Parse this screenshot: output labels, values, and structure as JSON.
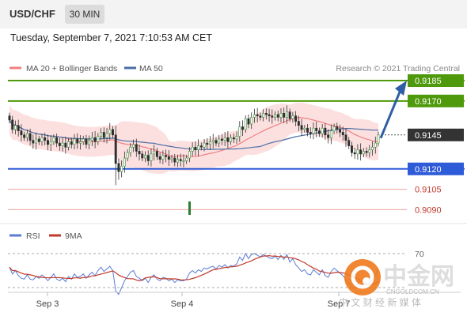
{
  "header": {
    "pair": "USD/CHF",
    "timeframe": "30 MIN",
    "timestamp": "Tuesday, September 7, 2021 7:10:53 AM CET"
  },
  "legend": {
    "ma20": "MA 20 + Bollinger Bands",
    "ma50": "MA 50",
    "source": "Research © 2021 Trading Central"
  },
  "rsi_legend": {
    "rsi": "RSI",
    "ma": "9MA"
  },
  "colors": {
    "resistance": "#4f9a0c",
    "pivot": "#2e5bd8",
    "support": "#f0a0a0",
    "support_text": "#c0392b",
    "current": "#333333",
    "arrow": "#2f5fa3",
    "ma20": "#f08080",
    "ma50": "#4a6fa5",
    "band": "#fbdada",
    "rsi": "#5b7bd5",
    "rsi_ma": "#c0392b"
  },
  "watermark": {
    "brand": "中金网",
    "site": "CNGOLDCOM.CN",
    "tagline": "中 文 财 经 新 媒 体"
  },
  "chart_data": {
    "type": "candlestick",
    "ylim": [
      0.9078,
      0.9192
    ],
    "x_ticks": [
      "Sep 3",
      "Sep 4",
      "Sep 7"
    ],
    "levels": [
      {
        "label": "0.9185",
        "value": 0.9185,
        "kind": "resistance"
      },
      {
        "label": "0.9170",
        "value": 0.917,
        "kind": "resistance"
      },
      {
        "label": "0.9145",
        "value": 0.9145,
        "kind": "current"
      },
      {
        "label": "0.9120",
        "value": 0.912,
        "kind": "pivot"
      },
      {
        "label": "0.9105",
        "value": 0.9105,
        "kind": "support"
      },
      {
        "label": "0.9090",
        "value": 0.909,
        "kind": "support"
      }
    ],
    "close": [
      0.9156,
      0.9149,
      0.9152,
      0.9148,
      0.9145,
      0.9143,
      0.9146,
      0.9141,
      0.9139,
      0.9142,
      0.914,
      0.9143,
      0.9141,
      0.9138,
      0.914,
      0.9143,
      0.9139,
      0.9137,
      0.9139,
      0.9136,
      0.914,
      0.9138,
      0.9142,
      0.9139,
      0.914,
      0.9142,
      0.9138,
      0.9141,
      0.9143,
      0.914,
      0.9144,
      0.9147,
      0.9143,
      0.9146,
      0.9149,
      0.9145,
      0.9124,
      0.9118,
      0.9122,
      0.9128,
      0.9132,
      0.9136,
      0.9138,
      0.9133,
      0.9131,
      0.9128,
      0.913,
      0.9126,
      0.9131,
      0.9133,
      0.9129,
      0.9127,
      0.913,
      0.9129,
      0.9127,
      0.9128,
      0.9125,
      0.9127,
      0.9126,
      0.9126,
      0.9128,
      0.9133,
      0.9136,
      0.9134,
      0.9137,
      0.9136,
      0.9139,
      0.9138,
      0.914,
      0.9141,
      0.9139,
      0.9142,
      0.9141,
      0.9143,
      0.914,
      0.9143,
      0.9142,
      0.9144,
      0.9151,
      0.9149,
      0.9157,
      0.9153,
      0.9158,
      0.916,
      0.9159,
      0.9158,
      0.9161,
      0.916,
      0.9159,
      0.9158,
      0.916,
      0.9158,
      0.9161,
      0.9158,
      0.9162,
      0.9157,
      0.9159,
      0.9155,
      0.9152,
      0.9149,
      0.915,
      0.9147,
      0.9146,
      0.915,
      0.9148,
      0.9146,
      0.915,
      0.9145,
      0.9143,
      0.9148,
      0.9151,
      0.9149,
      0.9147,
      0.9145,
      0.9141,
      0.9137,
      0.9132,
      0.9131,
      0.9134,
      0.9131,
      0.9133,
      0.9132,
      0.9134,
      0.9136,
      0.9139,
      0.9145
    ],
    "rsi": [
      54,
      46,
      50,
      44,
      41,
      40,
      45,
      40,
      39,
      43,
      41,
      45,
      42,
      38,
      42,
      46,
      40,
      38,
      41,
      37,
      43,
      40,
      46,
      42,
      43,
      46,
      41,
      45,
      48,
      44,
      50,
      54,
      49,
      52,
      55,
      50,
      26,
      22,
      30,
      38,
      43,
      48,
      50,
      43,
      41,
      38,
      41,
      36,
      42,
      45,
      40,
      38,
      42,
      41,
      38,
      40,
      36,
      39,
      38,
      38,
      40,
      47,
      50,
      47,
      51,
      49,
      53,
      52,
      54,
      55,
      52,
      56,
      54,
      57,
      53,
      56,
      55,
      58,
      66,
      62,
      70,
      64,
      69,
      70,
      68,
      66,
      69,
      67,
      65,
      64,
      67,
      63,
      68,
      63,
      69,
      60,
      64,
      57,
      53,
      49,
      51,
      46,
      45,
      51,
      48,
      45,
      51,
      44,
      42,
      49,
      53,
      50,
      47,
      44,
      39,
      35,
      30,
      29,
      35,
      31,
      34,
      33,
      36,
      39,
      44,
      52
    ]
  }
}
